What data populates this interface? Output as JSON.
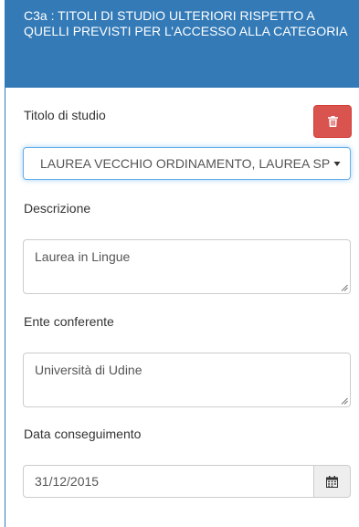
{
  "panel": {
    "heading": "C3a : TITOLI DI STUDIO ULTERIORI RISPETTO A QUELLI PREVISTI PER L’ACCESSO ALLA CATEGORIA"
  },
  "form": {
    "titolo_label": "Titolo di studio",
    "titolo_value": "LAUREA VECCHIO ORDINAMENTO, LAUREA SPECIALISTICA, LAUREA MAGISTRALE",
    "descrizione_label": "Descrizione",
    "descrizione_value": "Laurea in Lingue",
    "ente_label": "Ente conferente",
    "ente_value": "Università di Udine",
    "data_label": "Data conseguimento",
    "data_value": "31/12/2015"
  },
  "icons": {
    "delete": "trash-icon",
    "calendar": "calendar-icon",
    "dropdown": "caret-down-icon",
    "resize": "resize-grip-icon"
  },
  "colors": {
    "heading_bg": "#337ab7",
    "delete_bg": "#d9534f",
    "focus_border": "#66afe9"
  }
}
